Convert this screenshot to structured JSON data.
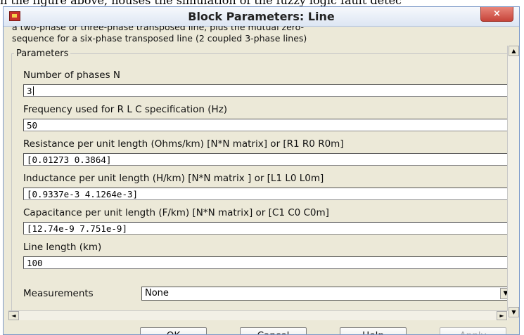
{
  "page_caption": "n the figure above, houses the simulation of the fuzzy logic fault detec",
  "window": {
    "title": "Block Parameters: Line",
    "close_label": "×"
  },
  "description": [
    "a two-phase or  three-phase transposed  line, plus the mutual zero-",
    "sequence for a  six-phase transposed  line  (2 coupled 3-phase lines)"
  ],
  "parameters": {
    "group_label": "Parameters",
    "fields": [
      {
        "label": "Number of phases N",
        "value": "3"
      },
      {
        "label": "Frequency used for R L C specification (Hz)",
        "value": "50"
      },
      {
        "label": "Resistance per unit length (Ohms/km)   [N*N matrix] or [R1 R0 R0m]",
        "value": "[0.01273 0.3864]"
      },
      {
        "label": "Inductance per unit length (H/km) [N*N matrix ] or [L1 L0 L0m]",
        "value": "[0.9337e-3  4.1264e-3]"
      },
      {
        "label": "Capacitance per unit length (F/km) [N*N matrix] or [C1 C0 C0m]",
        "value": "[12.74e-9 7.751e-9]"
      },
      {
        "label": "Line length (km)",
        "value": "100"
      }
    ],
    "measurements_label": "Measurements",
    "measurements_value": "None"
  },
  "scroll": {
    "up": "▲",
    "down": "▼",
    "left": "◄",
    "right": "►"
  },
  "buttons": {
    "ok": "OK",
    "cancel": "Cancel",
    "help": "Help",
    "apply": "Apply"
  }
}
